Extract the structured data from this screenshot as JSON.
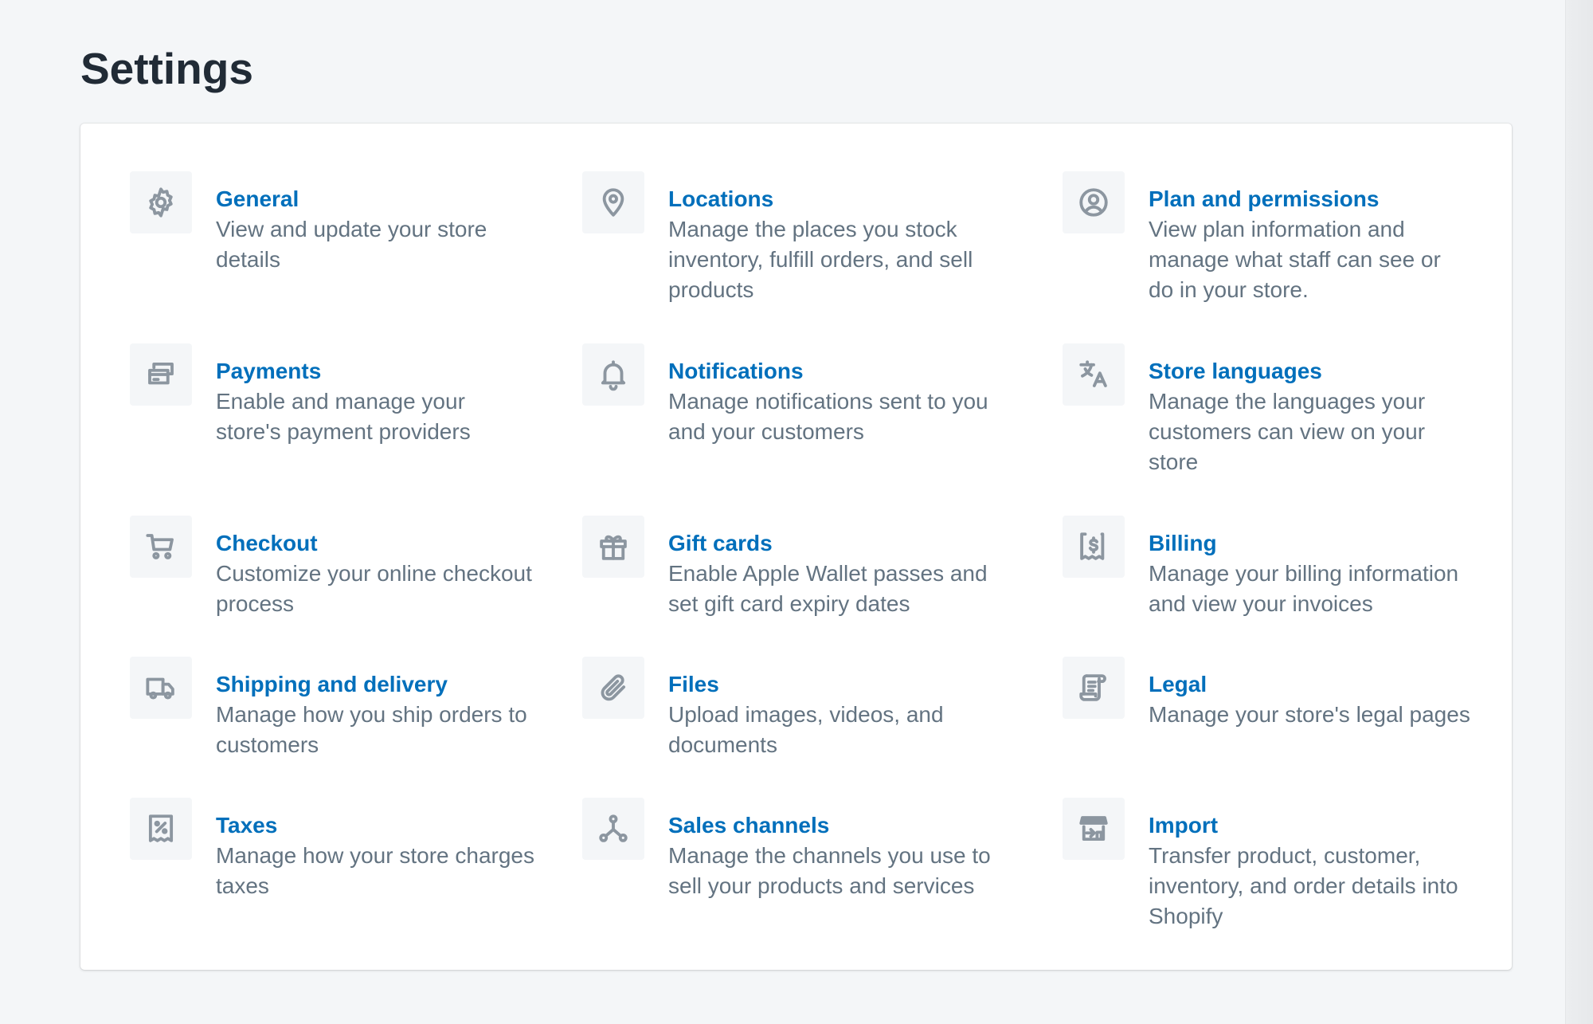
{
  "page": {
    "title": "Settings"
  },
  "settings": [
    {
      "title": "General",
      "description": "View and update your store details",
      "icon": "gear-icon"
    },
    {
      "title": "Locations",
      "description": "Manage the places you stock inventory, fulfill orders, and sell products",
      "icon": "location-pin-icon"
    },
    {
      "title": "Plan and permissions",
      "description": "View plan information and manage what staff can see or do in your store.",
      "icon": "profile-icon"
    },
    {
      "title": "Payments",
      "description": "Enable and manage your store's payment providers",
      "icon": "payment-cards-icon"
    },
    {
      "title": "Notifications",
      "description": "Manage notifications sent to you and your customers",
      "icon": "bell-icon"
    },
    {
      "title": "Store languages",
      "description": "Manage the languages your customers can view on your store",
      "icon": "translate-icon"
    },
    {
      "title": "Checkout",
      "description": "Customize your online checkout process",
      "icon": "cart-icon"
    },
    {
      "title": "Gift cards",
      "description": "Enable Apple Wallet passes and set gift card expiry dates",
      "icon": "gift-icon"
    },
    {
      "title": "Billing",
      "description": "Manage your billing information and view your invoices",
      "icon": "billing-receipt-icon"
    },
    {
      "title": "Shipping and delivery",
      "description": "Manage how you ship orders to customers",
      "icon": "truck-icon"
    },
    {
      "title": "Files",
      "description": "Upload images, videos, and documents",
      "icon": "paperclip-icon"
    },
    {
      "title": "Legal",
      "description": "Manage your store's legal pages",
      "icon": "legal-document-icon"
    },
    {
      "title": "Taxes",
      "description": "Manage how your store charges taxes",
      "icon": "tax-receipt-icon"
    },
    {
      "title": "Sales channels",
      "description": "Manage the channels you use to sell your products and services",
      "icon": "sales-channels-icon"
    },
    {
      "title": "Import",
      "description": "Transfer product, customer, inventory, and order details into Shopify",
      "icon": "import-store-icon"
    }
  ],
  "colors": {
    "background": "#f4f6f8",
    "link": "#006fbb",
    "text_muted": "#637381",
    "heading": "#212b36",
    "icon": "#8c96a0"
  }
}
